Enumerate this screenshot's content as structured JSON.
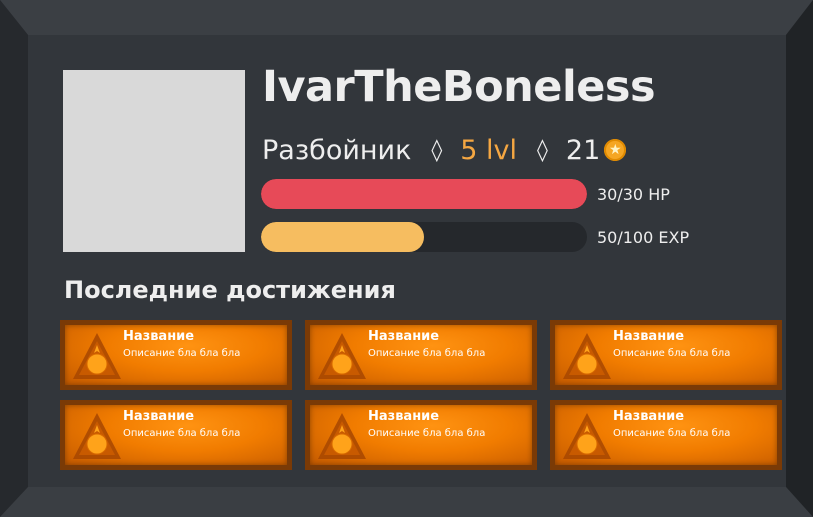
{
  "profile": {
    "username": "IvarTheBoneless",
    "class_name": "Разбойник",
    "separator": "◊",
    "level": "5 lvl",
    "coins": "21",
    "coin_icon": "coin-icon"
  },
  "stats": {
    "hp": {
      "label": "30/30 HP",
      "fraction": 1.0,
      "color": "#e74a58"
    },
    "exp": {
      "label": "50/100 EXP",
      "fraction": 0.5,
      "color": "#f6bd60"
    }
  },
  "achievements": {
    "title": "Последние достижения",
    "items": [
      {
        "title": "Название",
        "description": "Описание бла бла бла",
        "icon": "achievement-badge-icon"
      },
      {
        "title": "Название",
        "description": "Описание бла бла бла",
        "icon": "achievement-badge-icon"
      },
      {
        "title": "Название",
        "description": "Описание бла бла бла",
        "icon": "achievement-badge-icon"
      },
      {
        "title": "Название",
        "description": "Описание бла бла бла",
        "icon": "achievement-badge-icon"
      },
      {
        "title": "Название",
        "description": "Описание бла бла бла",
        "icon": "achievement-badge-icon"
      },
      {
        "title": "Название",
        "description": "Описание бла бла бла",
        "icon": "achievement-badge-icon"
      }
    ]
  },
  "colors": {
    "background": "#32363b",
    "accent_level": "#f5a742",
    "achievement_bg": "#f17c00"
  }
}
